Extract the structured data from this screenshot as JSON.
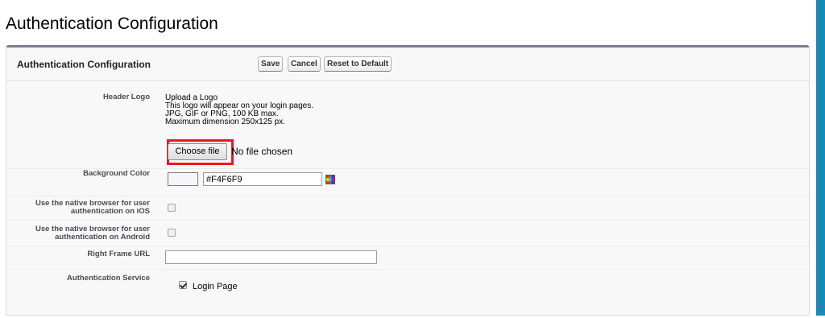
{
  "page": {
    "title": "Authentication Configuration"
  },
  "panel": {
    "title": "Authentication Configuration",
    "buttons": {
      "save": "Save",
      "cancel": "Cancel",
      "reset": "Reset to Default"
    }
  },
  "header_logo": {
    "label": "Header Logo",
    "help": [
      "Upload a Logo",
      "This logo will appear on your login pages.",
      "JPG, GIF or PNG, 100 KB max.",
      "Maximum dimension 250x125 px."
    ],
    "choose_file": "Choose file",
    "no_file": "No file chosen"
  },
  "background_color": {
    "label": "Background Color",
    "value": "#F4F6F9",
    "swatch_color": "#f4f6f9"
  },
  "native_ios": {
    "label": "Use the native browser for user authentication on iOS",
    "checked": false
  },
  "native_android": {
    "label": "Use the native browser for user authentication on Android",
    "checked": false
  },
  "right_frame_url": {
    "label": "Right Frame URL",
    "value": ""
  },
  "auth_service": {
    "label": "Authentication Service",
    "option": "Login Page",
    "checked": true
  },
  "colors": {
    "accent_bar": "#1b8ab8",
    "panel_top_border": "#747e96",
    "highlight_box": "#e8191f"
  },
  "icons": {
    "color_palette": "color-picker-icon"
  }
}
